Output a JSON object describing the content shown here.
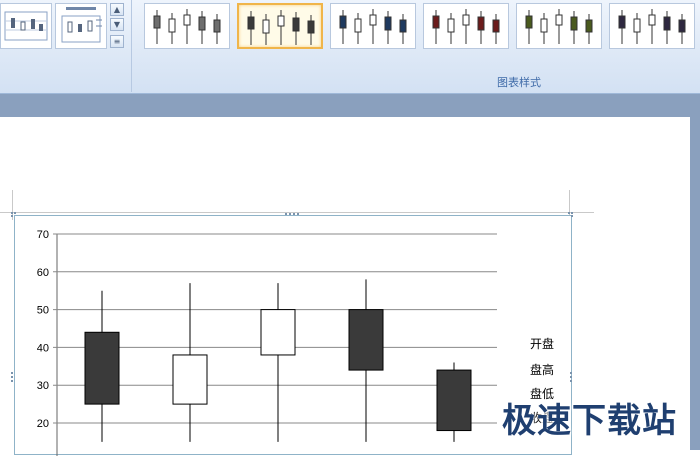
{
  "ribbon": {
    "group_label": "图表样式",
    "layout_thumbnails": [
      "layout-1",
      "layout-2"
    ],
    "styles": [
      {
        "up": "#ffffff",
        "down": "#6e6e6e",
        "selected": false
      },
      {
        "up": "#ffffff",
        "down": "#3a3a3a",
        "selected": true
      },
      {
        "up": "#ffffff",
        "down": "#1f3a5f",
        "selected": false
      },
      {
        "up": "#ffffff",
        "down": "#6b1b1b",
        "selected": false
      },
      {
        "up": "#ffffff",
        "down": "#4a5a1e",
        "selected": false
      },
      {
        "up": "#ffffff",
        "down": "#2e2840",
        "selected": false
      }
    ]
  },
  "chart_data": {
    "type": "candlestick",
    "ylim": [
      15,
      70
    ],
    "y_ticks": [
      20,
      30,
      40,
      50,
      60,
      70
    ],
    "grid": true,
    "series_names": [
      "开盘",
      "盘高",
      "盘低",
      "收盘"
    ],
    "candles": [
      {
        "open": 44,
        "high": 55,
        "low": 15,
        "close": 25
      },
      {
        "open": 25,
        "high": 57,
        "low": 15,
        "close": 38
      },
      {
        "open": 38,
        "high": 57,
        "low": 15,
        "close": 50
      },
      {
        "open": 50,
        "high": 58,
        "low": 15,
        "close": 34
      },
      {
        "open": 34,
        "high": 36,
        "low": 15,
        "close": 18
      }
    ],
    "colors": {
      "up": "#ffffff",
      "down": "#3a3a3a"
    }
  },
  "watermark": "极速下载站"
}
